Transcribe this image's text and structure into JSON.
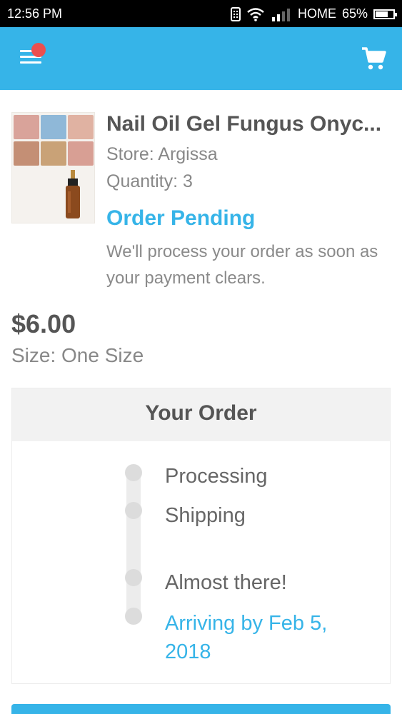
{
  "status_bar": {
    "time": "12:56 PM",
    "carrier": "HOME",
    "battery": "65%"
  },
  "app_bar": {
    "menu_icon": "hamburger-menu-icon",
    "notification_dot_color": "#EB4F4F",
    "cart_icon": "shopping-cart-icon",
    "color": "#36B4E8"
  },
  "product": {
    "title": "Nail Oil Gel Fungus Onyc...",
    "store": "Store: Argissa",
    "quantity": "Quantity: 3",
    "status": "Order Pending",
    "status_description": "We'll process your order as soon as your payment clears.",
    "price": "$6.00",
    "size": "Size: One Size"
  },
  "order": {
    "heading": "Your Order",
    "steps": [
      {
        "label": "Processing"
      },
      {
        "label": "Shipping"
      },
      {
        "label": "Almost there!"
      },
      {
        "label": "Arriving by Feb 5, 2018"
      }
    ]
  }
}
